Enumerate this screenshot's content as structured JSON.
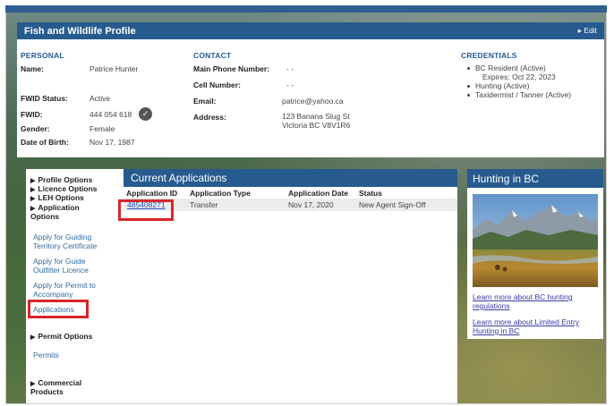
{
  "profile": {
    "title": "Fish and Wildlife Profile",
    "edit_label": "▸ Edit",
    "personal": {
      "heading": "PERSONAL",
      "name_label": "Name:",
      "name": "Patrice Hunter",
      "fwid_status_label": "FWID Status:",
      "fwid_status": "Active",
      "fwid_label": "FWID:",
      "fwid": "444 054 618",
      "gender_label": "Gender:",
      "gender": "Female",
      "dob_label": "Date of Birth:",
      "dob": "Nov 17, 1987"
    },
    "contact": {
      "heading": "CONTACT",
      "main_phone_label": "Main Phone Number:",
      "main_phone": "- -",
      "cell_label": "Cell Number:",
      "cell": "- -",
      "email_label": "Email:",
      "email": "patrice@yahoo.ca",
      "address_label": "Address:",
      "address_line1": "123 Banana Slug St",
      "address_line2": "Victoria BC V8V1R6"
    },
    "credentials": {
      "heading": "CREDENTIALS",
      "items": [
        "BC Resident (Active)",
        "Expires: Oct 22, 2023",
        "Hunting (Active)",
        "Taxidermist / Tanner (Active)"
      ]
    }
  },
  "sidebar": {
    "profile_options": "Profile Options",
    "licence_options": "Licence Options",
    "leh_options": "LEH Options",
    "application_options_1": "Application",
    "application_options_2": "Options",
    "links": {
      "guiding_1": "Apply for Guiding",
      "guiding_2": "Territory Certificate",
      "guide_outfitter_1": "Apply for Guide",
      "guide_outfitter_2": "Outfitter Licence",
      "permit_accompany_1": "Apply for Permit to",
      "permit_accompany_2": "Accompany",
      "applications": "Applications"
    },
    "permit_options": "Permit Options",
    "permits": "Permits",
    "commercial_1": "Commercial",
    "commercial_2": "Products"
  },
  "applications": {
    "title": "Current Applications",
    "columns": [
      "Application ID",
      "Application Type",
      "Application Date",
      "Status"
    ],
    "rows": [
      {
        "id": "485408271",
        "type": "Transfer",
        "date": "Nov 17, 2020",
        "status": "New Agent Sign-Off"
      }
    ]
  },
  "hunting": {
    "title": "Hunting in BC",
    "link1_line1": "Learn more about BC hunting",
    "link1_line2": "regulations",
    "link2_line1": "Learn more about Limited Entry",
    "link2_line2": "Hunting in BC"
  },
  "colors": {
    "header_blue": "#275b8f",
    "link_blue": "#2f6aa3",
    "highlight_red": "#d9252a"
  }
}
